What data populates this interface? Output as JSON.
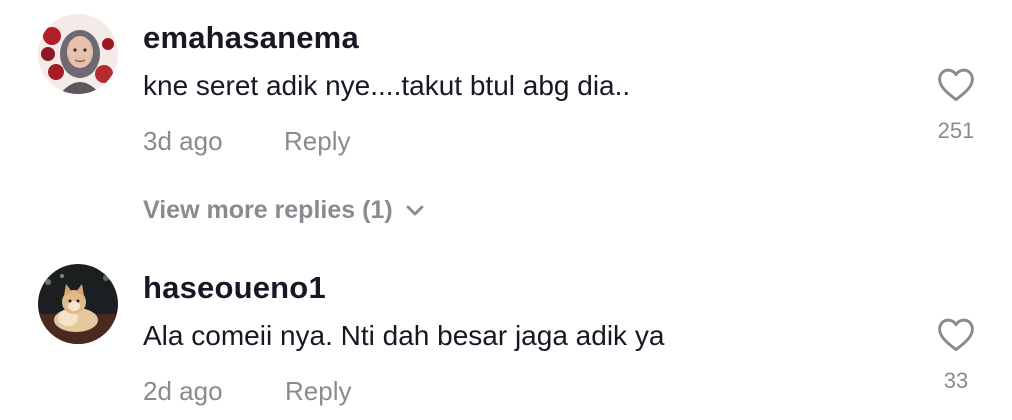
{
  "comments": [
    {
      "username": "emahasanema",
      "text": "kne seret adik nye....takut btul abg dia..",
      "time": "3d ago",
      "reply_label": "Reply",
      "likes": "251",
      "avatar_icon": "user-avatar-photo",
      "like_icon": "heart-outline-icon"
    },
    {
      "username": "haseoueno1",
      "text": "Ala comeii nya. Nti dah besar jaga adik ya",
      "time": "2d ago",
      "reply_label": "Reply",
      "likes": "33",
      "avatar_icon": "cat-avatar-photo",
      "like_icon": "heart-outline-icon"
    }
  ],
  "view_more": {
    "label": "View more replies (1)",
    "icon": "chevron-down-icon"
  },
  "colors": {
    "primary_text": "#161823",
    "secondary_text": "#8a8b91"
  }
}
